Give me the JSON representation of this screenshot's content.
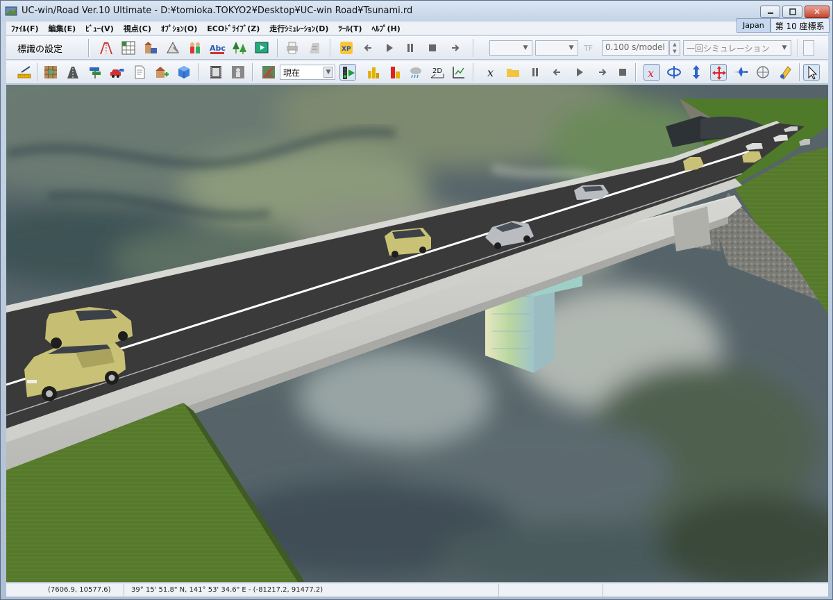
{
  "window": {
    "title": "UC-win/Road Ver.10 Ultimate - D:¥tomioka.TOKYO2¥Desktop¥UC-win Road¥Tsunami.rd"
  },
  "menu": {
    "items": [
      {
        "label": "ﾌｧｲﾙ(F)"
      },
      {
        "label": "編集(E)"
      },
      {
        "label": "ﾋﾞｭｰ(V)"
      },
      {
        "label": "視点(C)"
      },
      {
        "label": "ｵﾌﾟｼｮﾝ(O)"
      },
      {
        "label": "ECOﾄﾞﾗｲﾌﾞ(Z)"
      },
      {
        "label": "走行ｼﾐｭﾚｰｼｮﾝ(D)"
      },
      {
        "label": "ﾂｰﾙ(T)"
      },
      {
        "label": "ﾍﾙﾌﾟ(H)"
      }
    ],
    "region": "Japan",
    "coord_system": "第 10 座標系"
  },
  "toolbar1": {
    "sign_settings_label": "標識の設定",
    "speed_value": "0.100 s/model",
    "simulation_mode": "一回シミュレーション"
  },
  "toolbar2": {
    "time_select": "現在",
    "icon_2d_label": "2D"
  },
  "statusbar": {
    "view_coords": "(7606.9, 10577.6)",
    "geo_coords": "39°  15' 51.8\" N, 141°  53' 34.6\" E  -  (-81217.2, 91477.2)"
  },
  "colors": {
    "road_asphalt": "#3a3a3a",
    "bridge_concrete": "#c9c9c7",
    "grass": "#5a7d2e",
    "car_yellow": "#c9c276",
    "car_silver": "#b9bcc0",
    "accent_red": "#d22a1e",
    "accent_blue": "#2c62c8"
  }
}
